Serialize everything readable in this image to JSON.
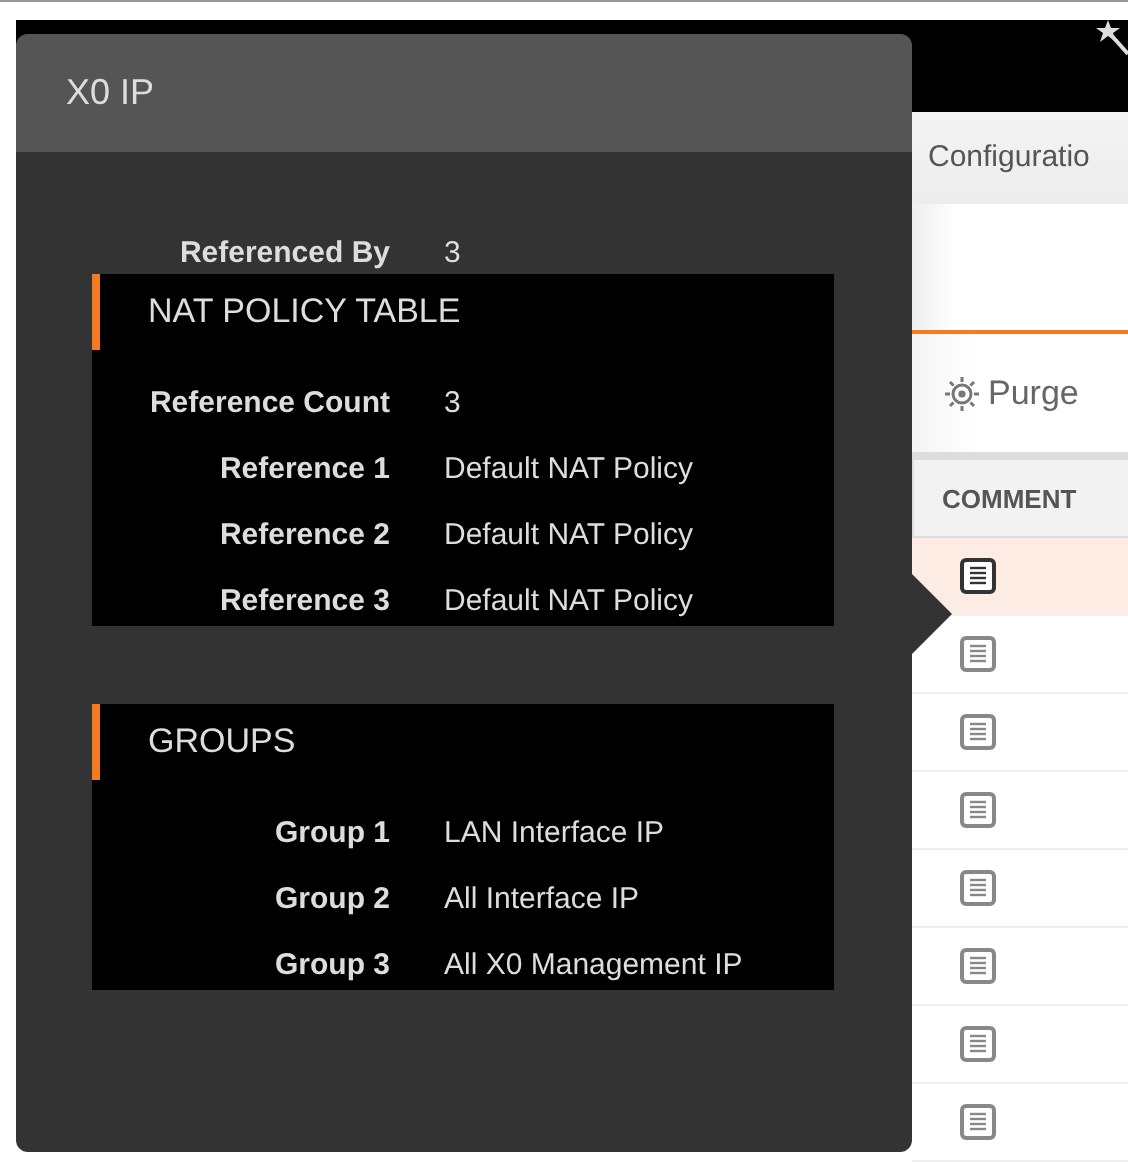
{
  "tabs": [
    {
      "label": "Configuratio",
      "selected": false
    }
  ],
  "toolbar": {
    "purge_button": "Purge"
  },
  "table": {
    "columns": [
      "COMMENT"
    ],
    "rows": [
      {
        "selected": true
      },
      {
        "selected": false
      },
      {
        "selected": false
      },
      {
        "selected": false
      },
      {
        "selected": false
      },
      {
        "selected": false
      },
      {
        "selected": false
      },
      {
        "selected": false
      }
    ]
  },
  "popover": {
    "title": "X0 IP",
    "referenced_by": {
      "label": "Referenced By",
      "value": "3"
    },
    "sections": [
      {
        "title": "NAT POLICY TABLE",
        "rows": [
          {
            "label": "Reference Count",
            "value": "3"
          },
          {
            "label": "Reference 1",
            "value": "Default NAT Policy"
          },
          {
            "label": "Reference 2",
            "value": "Default NAT Policy"
          },
          {
            "label": "Reference 3",
            "value": "Default NAT Policy"
          }
        ]
      },
      {
        "title": "GROUPS",
        "rows": [
          {
            "label": "Group 1",
            "value": "LAN Interface IP"
          },
          {
            "label": "Group 2",
            "value": "All Interface IP"
          },
          {
            "label": "Group 3",
            "value": "All X0 Management IP"
          }
        ]
      }
    ]
  }
}
